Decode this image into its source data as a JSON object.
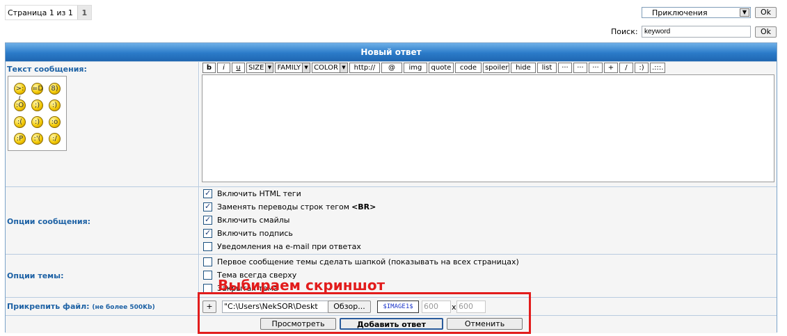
{
  "pagination": {
    "text": "Страница 1 из 1",
    "current": "1"
  },
  "forum_select": {
    "selected": "Приключения"
  },
  "ok_label": "Ok",
  "search": {
    "label": "Поиск:",
    "value": "keyword"
  },
  "form_title": "Новый ответ",
  "message": {
    "label": "Текст сообщения:"
  },
  "smilies": [
    "smiley-angry-icon",
    "smiley-grin-icon",
    "smiley-glasses-icon",
    "smiley-shocked-icon",
    "smiley-wink-icon",
    "smiley-happy-icon",
    "smiley-sad-icon",
    "smiley-smile-icon",
    "smiley-surprised-icon",
    "smiley-tongue-icon",
    "smiley-cry-icon",
    "smiley-smirk-icon"
  ],
  "toolbar": {
    "bold": "b",
    "italic": "i",
    "underline": "u",
    "size": "SIZE",
    "family": "FAMILY",
    "color": "COLOR",
    "http": "http://",
    "at": "@",
    "img": "img",
    "quote": "quote",
    "code": "code",
    "spoiler": "spoiler",
    "hide": "hide",
    "list": "list",
    "dots1": "···",
    "dots2": "···",
    "dots3": "···",
    "plus": "+",
    "slash": "/",
    "smile": ":)",
    "more": ".:::."
  },
  "options": {
    "label": "Опции сообщения:",
    "items": [
      {
        "text": "Включить HTML теги",
        "checked": true
      },
      {
        "text": "Заменять переводы строк тегом",
        "bold": "<BR>",
        "checked": true
      },
      {
        "text": "Включить смайлы",
        "checked": true
      },
      {
        "text": "Включить подпись",
        "checked": true
      },
      {
        "text": "Уведомления на e-mail при ответах",
        "checked": false
      }
    ]
  },
  "topic_options": {
    "label": "Опции темы:",
    "items": [
      {
        "text": "Первое сообщение темы сделать шапкой (показывать на всех страницах)",
        "checked": false
      },
      {
        "text": "Тема всегда сверху",
        "checked": false
      },
      {
        "text": "Закрытая тема",
        "checked": false
      }
    ]
  },
  "attach": {
    "label": "Прикрепить файл:",
    "note": "(не более 500Kb)",
    "add": "+",
    "path": "\"C:\\Users\\NekSOR\\Deskt",
    "browse": "Обзор...",
    "tag": "$IMAGE1$",
    "width": "600",
    "x": "x",
    "height": "600"
  },
  "buttons": {
    "preview": "Просмотреть",
    "submit": "Добавить ответ",
    "cancel": "Отменить"
  },
  "overlay": {
    "caption": "Выбираем скриншот",
    "color": "#e21c1c"
  }
}
